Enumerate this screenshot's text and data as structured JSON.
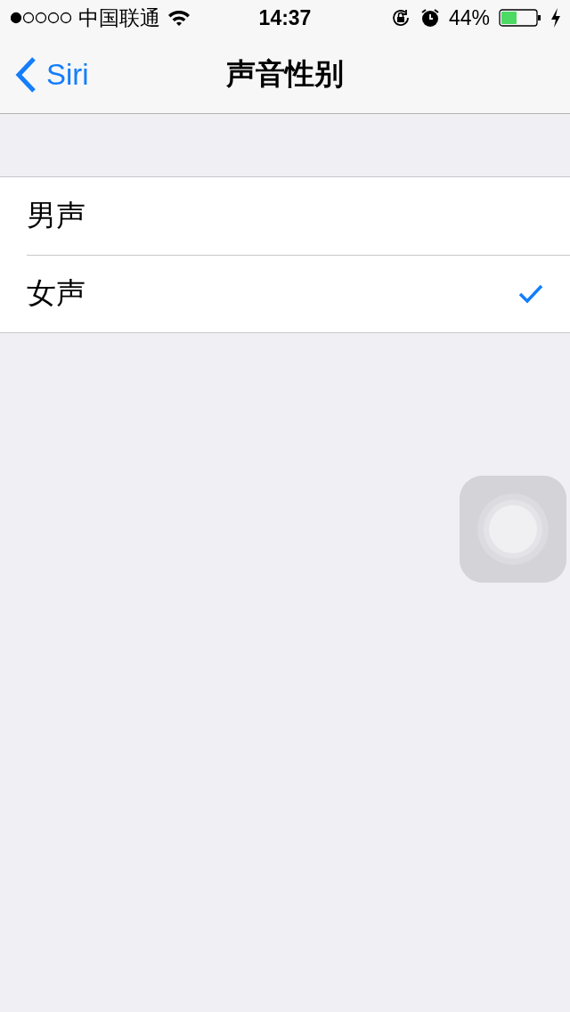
{
  "status_bar": {
    "carrier": "中国联通",
    "time": "14:37",
    "battery": "44%"
  },
  "nav_bar": {
    "back": "Siri",
    "title": "声音性别"
  },
  "options": [
    {
      "label": "男声",
      "selected": false
    },
    {
      "label": "女声",
      "selected": true
    }
  ]
}
